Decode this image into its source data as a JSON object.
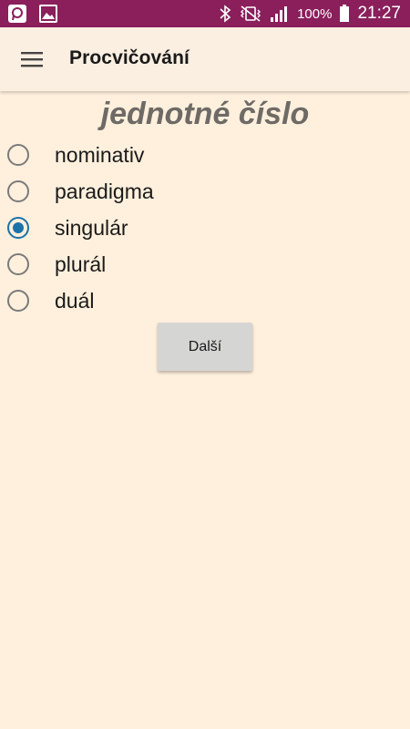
{
  "status_bar": {
    "battery_percent": "100%",
    "time": "21:27",
    "color": "#8a1f5c",
    "icons": [
      "app-notification-icon",
      "image-notification-icon",
      "bluetooth-icon",
      "vibrate-mute-icon",
      "signal-icon",
      "battery-icon"
    ]
  },
  "app_bar": {
    "title": "Procvičování",
    "menu_icon": "hamburger-menu-icon"
  },
  "question": {
    "text": "jednotné číslo"
  },
  "options": [
    {
      "label": "nominativ",
      "selected": false
    },
    {
      "label": "paradigma",
      "selected": false
    },
    {
      "label": "singulár",
      "selected": true
    },
    {
      "label": "plurál",
      "selected": false
    },
    {
      "label": "duál",
      "selected": false
    }
  ],
  "next_button": {
    "label": "Další"
  },
  "colors": {
    "background": "#fff0dd",
    "accent": "#1a73a8",
    "question_text": "#6e6a66"
  }
}
